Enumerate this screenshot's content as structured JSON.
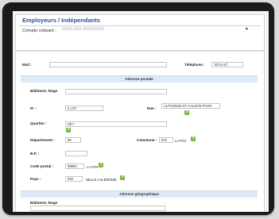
{
  "header": {
    "title": "Employeurs / Indépendants",
    "account_label": "Compte cotisant :",
    "account_value": "XXXX XXX XXXXXXXX",
    "dropdown_arrow": "▼"
  },
  "form": {
    "mail_label": "Mail :",
    "mail_value": "",
    "telephone_label": "Téléphone :",
    "telephone_value": "15/14-a/7",
    "postal_section_title": "Adresse postale",
    "batiment_label": "Bâtiment, étage",
    "batiment_value": "",
    "num_label": "N° :",
    "num_value": "6 LOT",
    "rue_label": "Rue :",
    "rue_value": "ALPHONSE ET CALMTE POVR",
    "quartier_label": "Quartier :",
    "quartier_value": "NEY",
    "departement_label": "Département :",
    "departement_value": "98",
    "commune_label": "Commune :",
    "commune_value": "913",
    "commune_name": "LA FOA",
    "bp_label": "B.P. :",
    "bp_value": "",
    "code_postal_label": "Code postal :",
    "code_postal_value": "98883",
    "code_postal_city": "LA FOA",
    "pays_label": "Pays :",
    "pays_value": "000",
    "pays_name": "NELLE CALEDONIE",
    "geo_section_title": "Adresse géographique",
    "geo_batiment_label": "Bâtiment, étage",
    "geo_batiment_value": "",
    "help_glyph": "?"
  }
}
